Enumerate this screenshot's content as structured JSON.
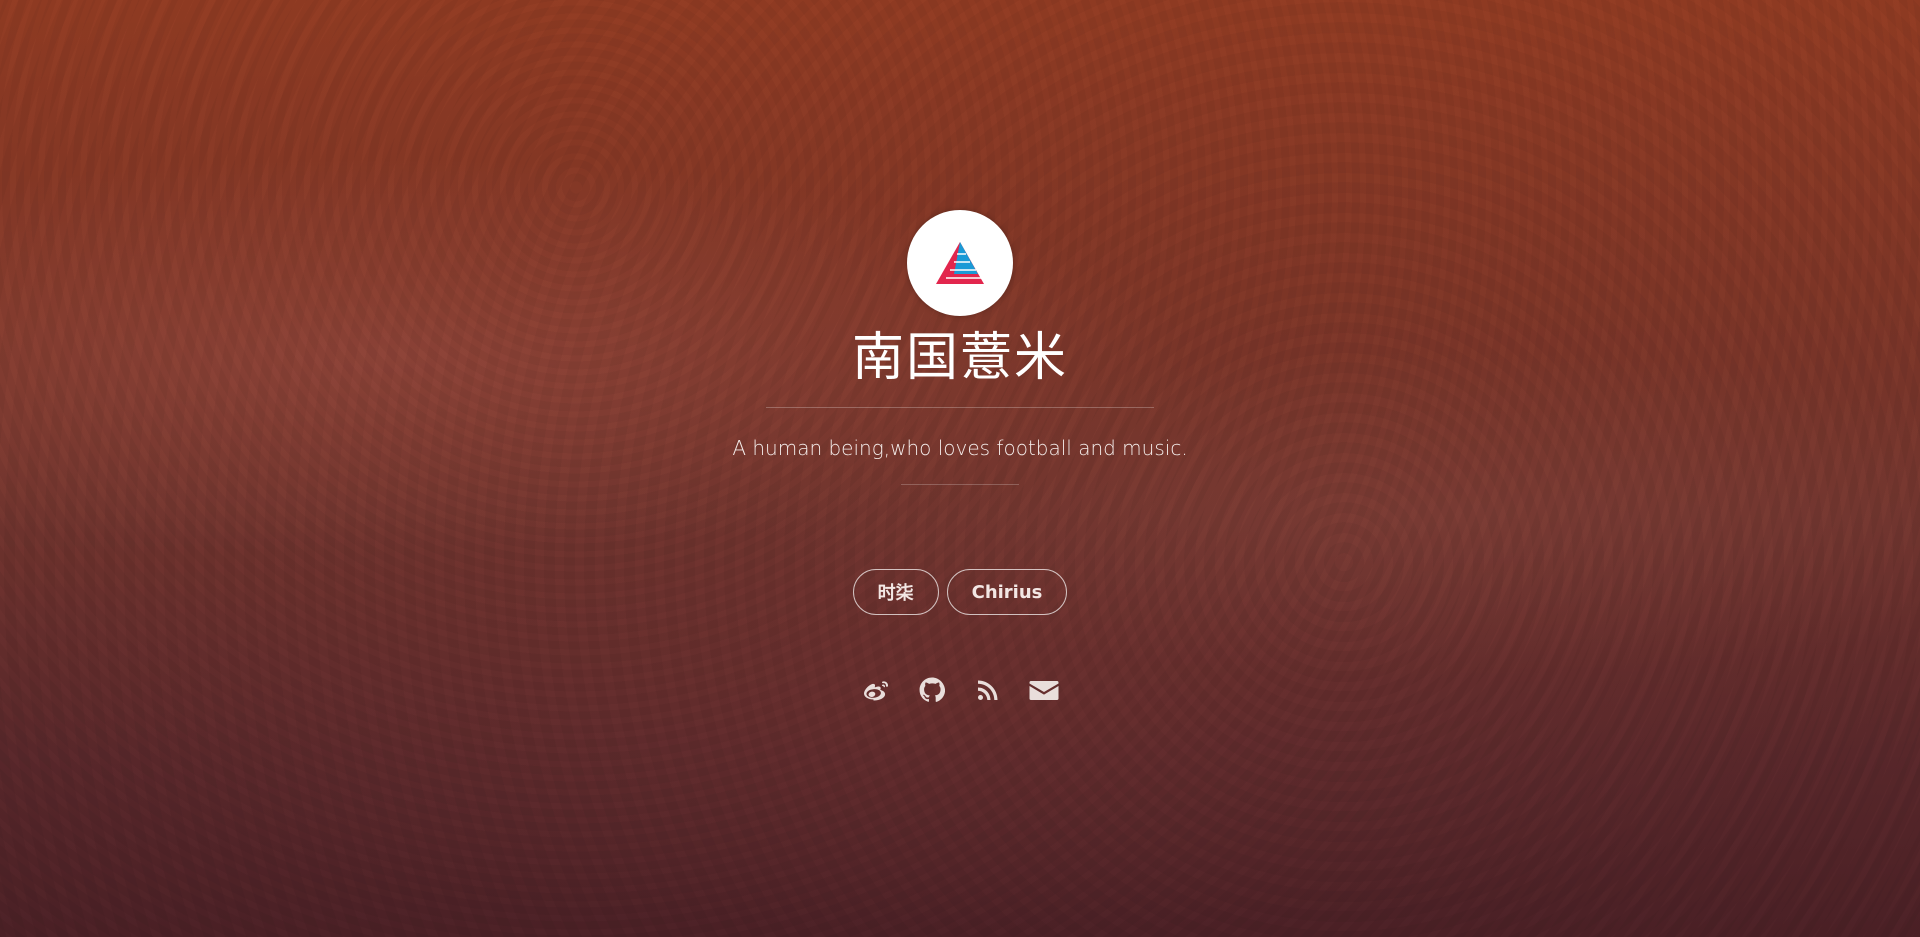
{
  "profile": {
    "avatar_icon": "triangle-logo-icon",
    "title": "南国薏米",
    "tagline": "A human being,who loves football and music."
  },
  "nav": {
    "items": [
      {
        "label": "时柒"
      },
      {
        "label": "Chirius"
      }
    ]
  },
  "social": [
    {
      "icon": "weibo-icon"
    },
    {
      "icon": "github-icon"
    },
    {
      "icon": "rss-icon"
    },
    {
      "icon": "email-icon"
    }
  ],
  "colors": {
    "background_top": "#8e3a22",
    "background_bottom": "#4a2025",
    "logo_red": "#e2264d",
    "logo_blue": "#1a9ad6"
  }
}
